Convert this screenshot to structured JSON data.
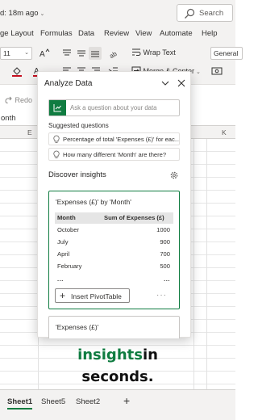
{
  "titlebar": {
    "saved_text": "d: 18m ago",
    "search_placeholder": "Search"
  },
  "ribbon_tabs": [
    "ge Layout",
    "Formulas",
    "Data",
    "Review",
    "View",
    "Automate",
    "Help"
  ],
  "ribbon": {
    "font_size": "11",
    "wrap_text": "Wrap Text",
    "merge_center": "Merge & Center",
    "number_format": "General",
    "redo": "Redo"
  },
  "name_box": "onth",
  "columns": [
    "E",
    "K"
  ],
  "pane": {
    "title": "Analyze Data",
    "ask_placeholder": "Ask a question about your data",
    "suggested_label": "Suggested questions",
    "suggestions": [
      "Percentage of total 'Expenses (£)' for eac...",
      "How many different 'Month' are there?"
    ],
    "discover_label": "Discover insights",
    "insight_card": {
      "title": "'Expenses (£)' by 'Month'",
      "headers": [
        "Month",
        "Sum of Expenses (£)"
      ],
      "rows": [
        {
          "month": "October",
          "value": "1000"
        },
        {
          "month": "July",
          "value": "900"
        },
        {
          "month": "April",
          "value": "700"
        },
        {
          "month": "February",
          "value": "500"
        }
      ],
      "ellipsis": "...",
      "insert_pivot": "Insert PivotTable",
      "more": "···"
    },
    "second_card_title": "'Expenses (£)'"
  },
  "caption": {
    "highlight": "insights",
    "rest_line1": "in",
    "line2": "seconds."
  },
  "sheets": [
    "Sheet1",
    "Sheet5",
    "Sheet2"
  ],
  "add_sheet": "+",
  "colors": {
    "accent_green": "#107c41",
    "ribbon_bg": "#f3f2f1"
  }
}
